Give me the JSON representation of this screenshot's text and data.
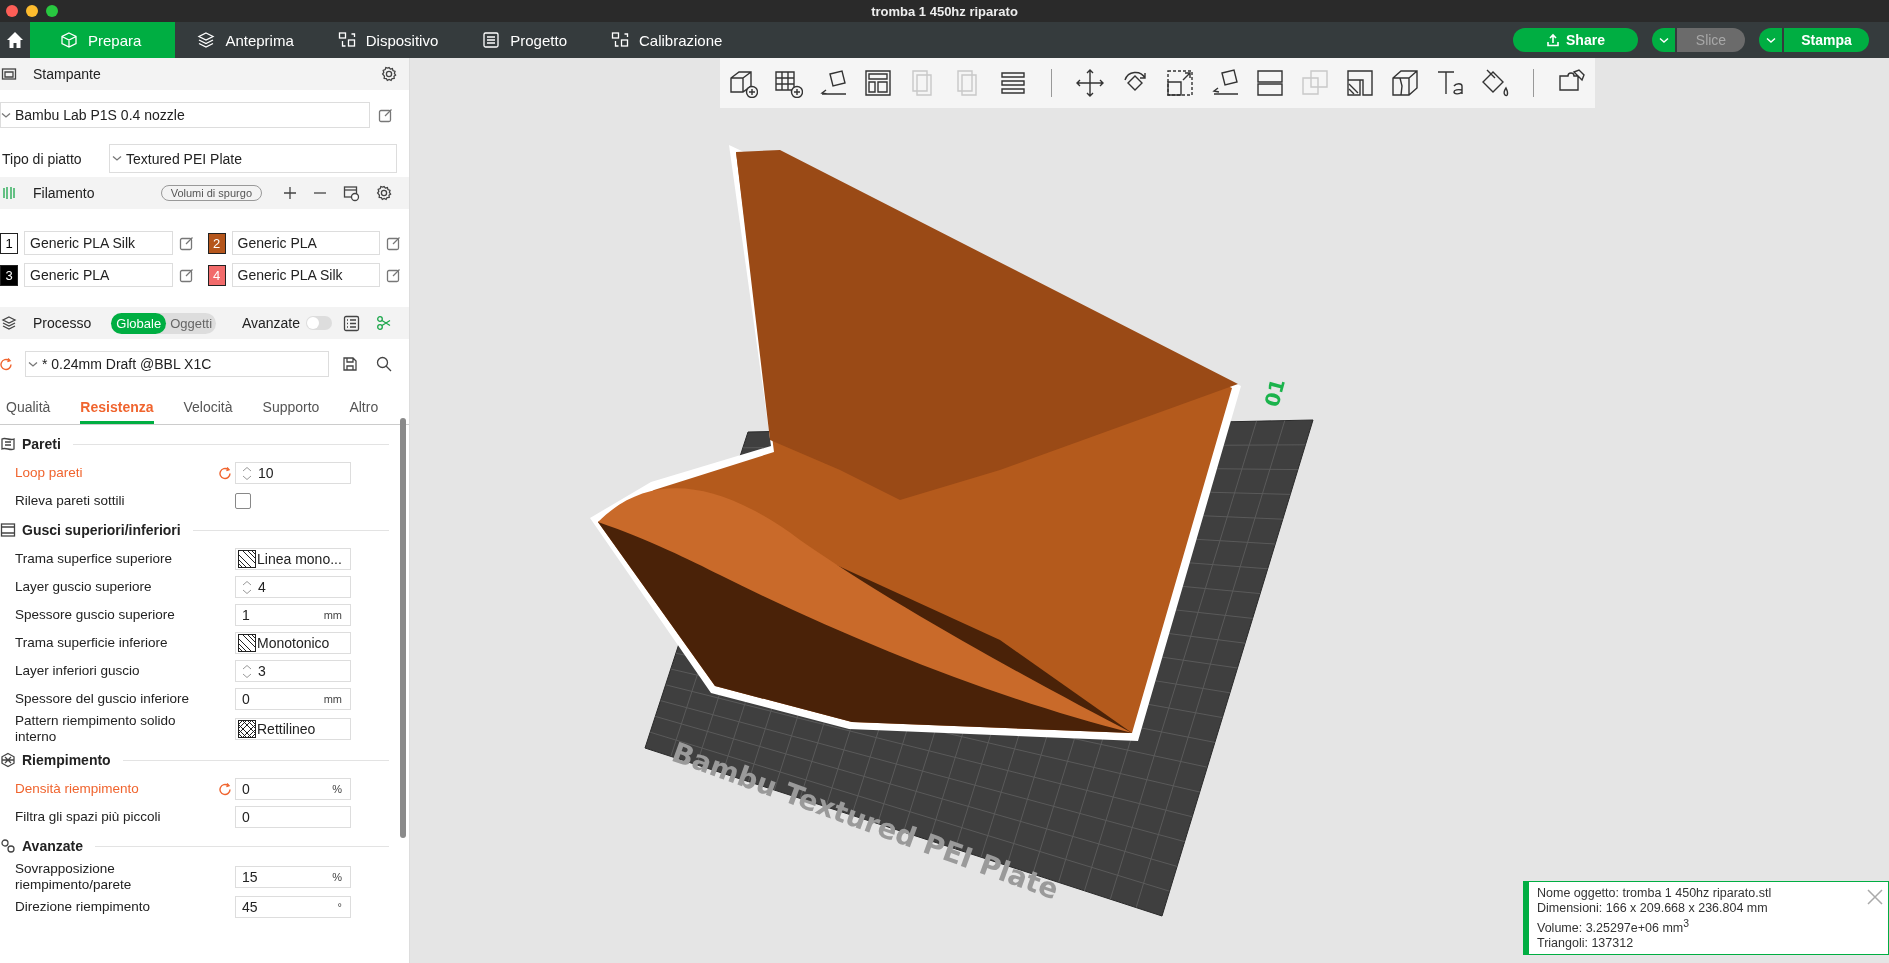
{
  "window": {
    "title": "tromba 1 450hz riparato"
  },
  "nav": {
    "tabs": [
      {
        "label": "Prepara",
        "selected": true
      },
      {
        "label": "Anteprima",
        "selected": false
      },
      {
        "label": "Dispositivo",
        "selected": false
      },
      {
        "label": "Progetto",
        "selected": false
      },
      {
        "label": "Calibrazione",
        "selected": false
      }
    ],
    "buttons": [
      {
        "label": "Share",
        "kind": "share"
      },
      {
        "label": "Slice",
        "kind": "split",
        "disabled": true
      },
      {
        "label": "Stampa",
        "kind": "split",
        "disabled": false
      }
    ]
  },
  "printer": {
    "title": "Stampante",
    "preset": "Bambu Lab P1S 0.4 nozzle",
    "plate_label": "Tipo di piatto",
    "plate_value": "Textured PEI Plate"
  },
  "filament": {
    "title": "Filamento",
    "flush_button": "Volumi di spurgo",
    "slots": [
      {
        "number": "1",
        "name": "Generic PLA Silk",
        "color": "#ffffff"
      },
      {
        "number": "2",
        "name": "Generic PLA",
        "color": "#b5561c"
      },
      {
        "number": "3",
        "name": "Generic PLA",
        "color": "#000000"
      },
      {
        "number": "4",
        "name": "Generic PLA Silk",
        "color": "#f26b6b"
      }
    ]
  },
  "process": {
    "title": "Processo",
    "scope": [
      {
        "label": "Globale",
        "selected": true
      },
      {
        "label": "Oggetti",
        "selected": false
      }
    ],
    "advanced_label": "Avanzate",
    "advanced_on": false,
    "preset": "* 0.24mm Draft @BBL X1C",
    "tabs": [
      {
        "label": "Qualità",
        "selected": false
      },
      {
        "label": "Resistenza",
        "selected": true
      },
      {
        "label": "Velocità",
        "selected": false
      },
      {
        "label": "Supporto",
        "selected": false
      },
      {
        "label": "Altro",
        "selected": false
      }
    ]
  },
  "settings": [
    {
      "title": "Pareti",
      "kind": "walls",
      "rows": [
        {
          "label": "Loop pareti",
          "kind": "spin",
          "value": "10",
          "modified": true
        },
        {
          "label": "Rileva pareti sottili",
          "kind": "check",
          "checked": false,
          "modified": false
        }
      ]
    },
    {
      "title": "Gusci superiori/inferiori",
      "kind": "shells",
      "rows": [
        {
          "label": "Trama superfice superiore",
          "kind": "pattern_diagonal",
          "value": "Linea mono...",
          "modified": false
        },
        {
          "label": "Layer guscio superiore",
          "kind": "spin",
          "value": "4",
          "modified": false
        },
        {
          "label": "Spessore guscio superiore",
          "kind": "unit",
          "value": "1",
          "unit": "mm",
          "modified": false
        },
        {
          "label": "Trama superficie inferiore",
          "kind": "pattern_diagonal",
          "value": "Monotonico",
          "modified": false
        },
        {
          "label": "Layer inferiori guscio",
          "kind": "spin",
          "value": "3",
          "modified": false
        },
        {
          "label": "Spessore del guscio inferiore",
          "kind": "unit",
          "value": "0",
          "unit": "mm",
          "modified": false
        },
        {
          "label": "Pattern riempimento solido interno",
          "kind": "pattern_cross",
          "value": "Rettilineo",
          "modified": false
        }
      ]
    },
    {
      "title": "Riempimento",
      "kind": "infill",
      "rows": [
        {
          "label": "Densità riempimento",
          "kind": "unit",
          "value": "0",
          "unit": "%",
          "modified": true
        },
        {
          "label": "Filtra gli spazi più piccoli",
          "kind": "plain",
          "value": "0",
          "modified": false
        }
      ]
    },
    {
      "title": "Avanzate",
      "kind": "advanced",
      "rows": [
        {
          "label": "Sovrapposizione riempimento/parete",
          "kind": "unit",
          "value": "15",
          "unit": "%",
          "modified": false
        },
        {
          "label": "Direzione riempimento",
          "kind": "unit",
          "value": "45",
          "unit": "°",
          "modified": false
        }
      ]
    }
  ],
  "toolbar": {
    "groups": [
      [
        {
          "disabled": false
        },
        {
          "disabled": false
        },
        {
          "disabled": false
        },
        {
          "disabled": false
        },
        {
          "disabled": true
        },
        {
          "disabled": true
        },
        {
          "disabled": false
        }
      ],
      [
        {
          "disabled": false
        },
        {
          "disabled": false
        },
        {
          "disabled": false
        },
        {
          "disabled": false
        },
        {
          "disabled": false
        },
        {
          "disabled": true
        },
        {
          "disabled": false
        },
        {
          "disabled": false
        },
        {
          "disabled": false
        },
        {
          "disabled": false
        }
      ],
      [
        {
          "disabled": false
        }
      ]
    ]
  },
  "scene": {
    "plate_text": "Bambu Textured PEI Plate",
    "plate_number": "01"
  },
  "info": {
    "lines": [
      "Nome oggetto: tromba 1 450hz riparato.stl",
      "Dimensioni: 166 x 209.668 x 236.804 mm",
      "Volume: 3.25297e+06 mm$^{3}$",
      "Triangoli: 137312"
    ]
  }
}
